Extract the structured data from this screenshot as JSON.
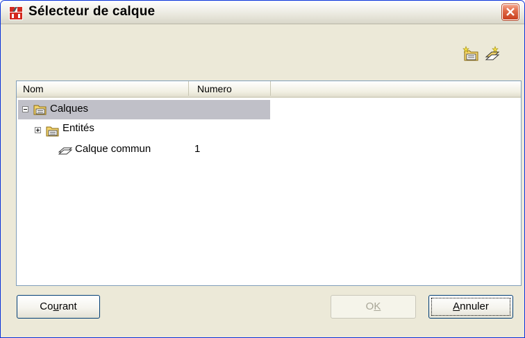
{
  "window": {
    "title": "Sélecteur de calque"
  },
  "toolbar": {
    "buttons": [
      {
        "icon": "new-folder-icon"
      },
      {
        "icon": "new-layer-icon"
      }
    ]
  },
  "list": {
    "columns": [
      "Nom",
      "Numero",
      ""
    ],
    "rows": [
      {
        "label": "Calques",
        "numero": "",
        "expander": "minus",
        "icon": "folder-icon",
        "selected": true
      },
      {
        "label": "Entités",
        "numero": "",
        "expander": "plus",
        "icon": "folder-icon",
        "selected": false
      },
      {
        "label": "Calque commun",
        "numero": "1",
        "expander": "none",
        "icon": "layer-icon",
        "selected": false
      }
    ]
  },
  "footer": {
    "courant": {
      "prefix": "Co",
      "accel": "u",
      "suffix": "rant"
    },
    "ok": {
      "prefix": "O",
      "accel": "K",
      "suffix": "",
      "disabled": true
    },
    "annuler": {
      "prefix": "",
      "accel": "A",
      "suffix": "nnuler"
    }
  },
  "colors": {
    "face": "#ece9d8",
    "selection": "#c0c0c8",
    "close": "#e06a48",
    "border": "#003c74"
  }
}
